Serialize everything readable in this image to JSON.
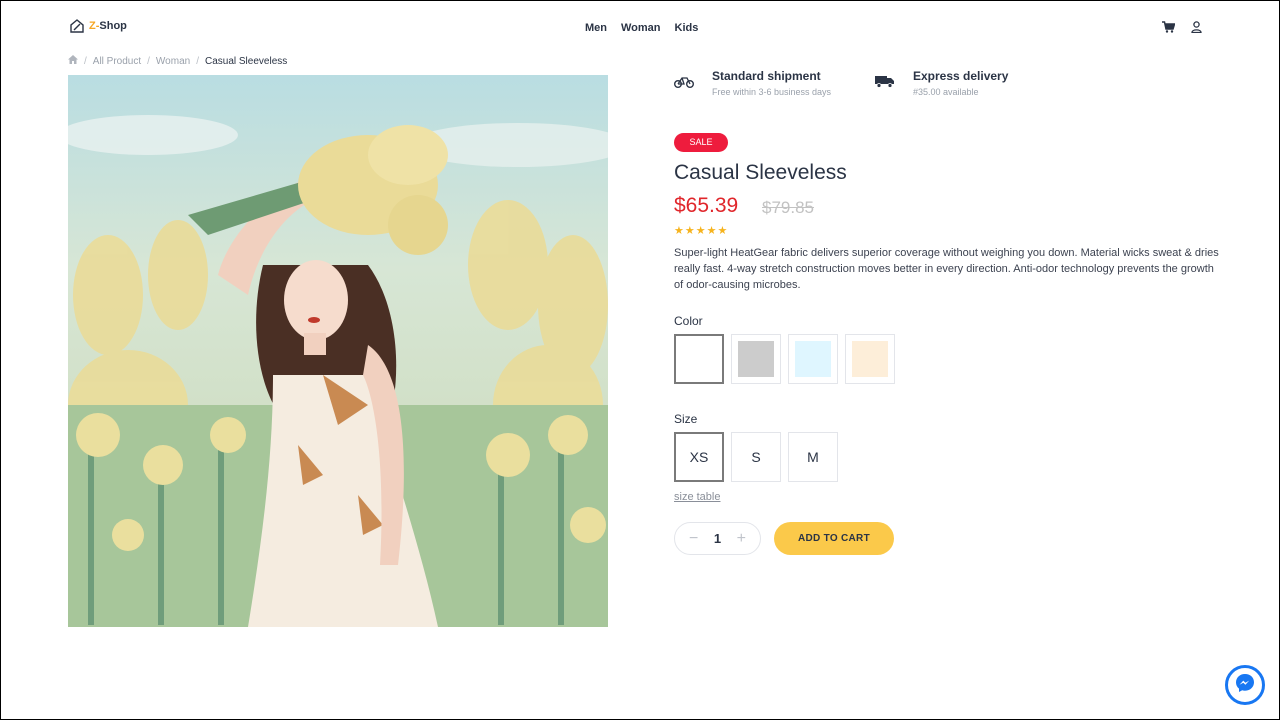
{
  "brand": {
    "name_prefix": "Z-",
    "name_suffix": "Shop"
  },
  "nav": {
    "items": [
      "Men",
      "Woman",
      "Kids"
    ]
  },
  "header_icons": [
    "cart-icon",
    "user-icon"
  ],
  "breadcrumb": {
    "items": [
      "All Product",
      "Woman"
    ],
    "current": "Casual Sleeveless",
    "separator": "/"
  },
  "shipping": [
    {
      "icon": "bicycle-icon",
      "title": "Standard shipment",
      "subtitle": "Free within 3-6 business days"
    },
    {
      "icon": "truck-icon",
      "title": "Express delivery",
      "subtitle": "#35.00 available"
    }
  ],
  "product": {
    "badge": "SALE",
    "title": "Casual Sleeveless",
    "price": "$65.39",
    "old_price": "$79.85",
    "rating": 5,
    "description": "Super-light HeatGear fabric delivers superior coverage without weighing you down. Material wicks sweat & dries really fast. 4-way stretch construction moves better in every direction. Anti-odor technology prevents the growth of odor-causing microbes."
  },
  "color": {
    "label": "Color",
    "options": [
      "#ffffff",
      "#cccccc",
      "#dff6ff",
      "#fdeed9"
    ],
    "selected_index": 0
  },
  "size": {
    "label": "Size",
    "options": [
      "XS",
      "S",
      "M"
    ],
    "selected_index": 0,
    "table_link": "size table"
  },
  "cart": {
    "quantity": "1",
    "minus": "−",
    "plus": "+",
    "add_label": "ADD TO CART"
  },
  "colors": {
    "accent": "#fbc94a",
    "sale": "#ee1c3d",
    "price": "#e0262b",
    "star": "#f6b31d",
    "messenger": "#1877f2"
  }
}
